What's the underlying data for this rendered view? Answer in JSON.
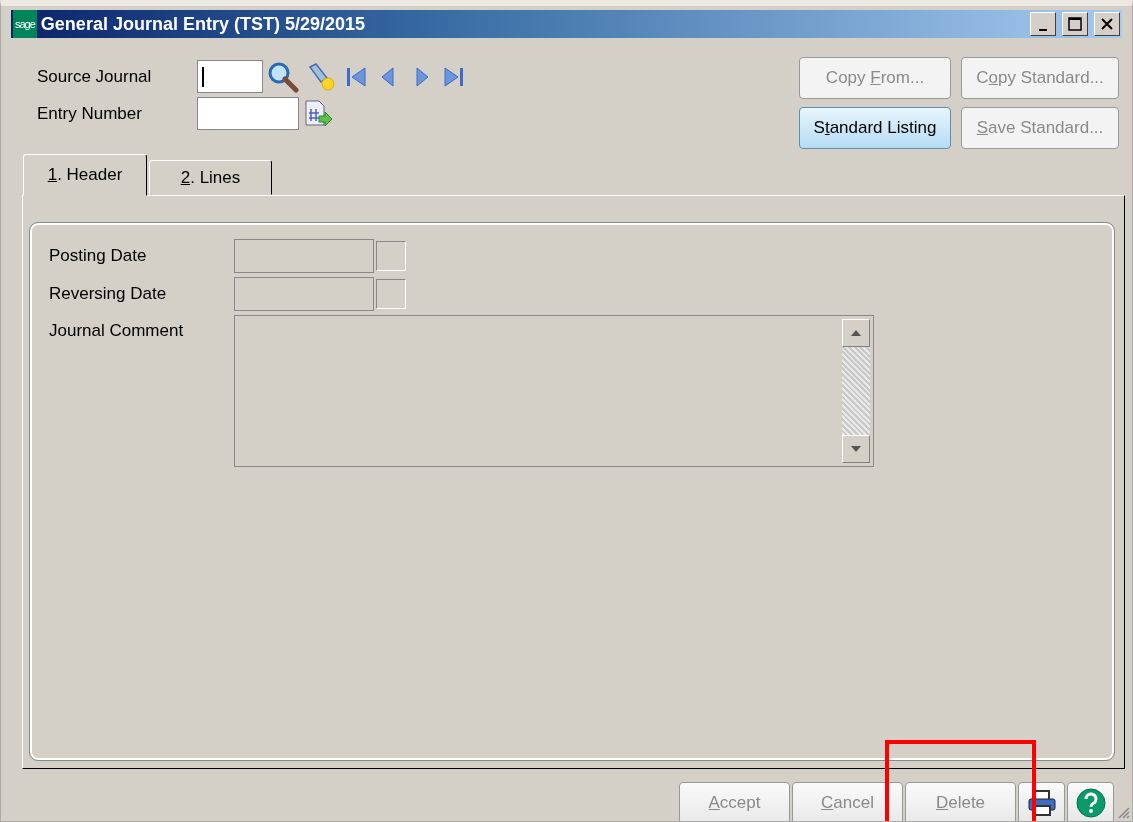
{
  "window": {
    "title": "General Journal Entry (TST) 5/29/2015",
    "app_badge": "sage"
  },
  "header_fields": [
    {
      "label": "Source Journal",
      "kind": "lookup",
      "focused": true
    },
    {
      "label": "Entry Number",
      "kind": "number",
      "focused": false
    }
  ],
  "action_buttons": [
    {
      "text_before": "Copy ",
      "mnemonic": "F",
      "text_after": "rom...",
      "disabled": true,
      "focused": false
    },
    {
      "text_before": "C",
      "mnemonic": "o",
      "text_after": "py Standard...",
      "disabled": true,
      "focused": false
    },
    {
      "text_before": "S",
      "mnemonic": "t",
      "text_after": "andard Listing",
      "disabled": false,
      "focused": true
    },
    {
      "mnemonic": "S",
      "text_after": "ave Standard...",
      "disabled": true,
      "focused": false
    }
  ],
  "tabs": [
    {
      "mnemonic": "1",
      "text_after": ". Header",
      "selected": true
    },
    {
      "mnemonic": "2",
      "text_after": ". Lines",
      "selected": false
    }
  ],
  "form_fields": [
    {
      "label": "Posting Date",
      "kind": "date",
      "disabled": true
    },
    {
      "label": "Reversing Date",
      "kind": "date",
      "disabled": true
    },
    {
      "label": "Journal Comment",
      "kind": "memo",
      "disabled": true
    }
  ],
  "footer_buttons": [
    {
      "mnemonic": "A",
      "text_after": "ccept",
      "disabled": true
    },
    {
      "mnemonic": "C",
      "text_after": "ancel",
      "disabled": true
    },
    {
      "mnemonic": "D",
      "text_after": "elete",
      "disabled": true
    }
  ]
}
